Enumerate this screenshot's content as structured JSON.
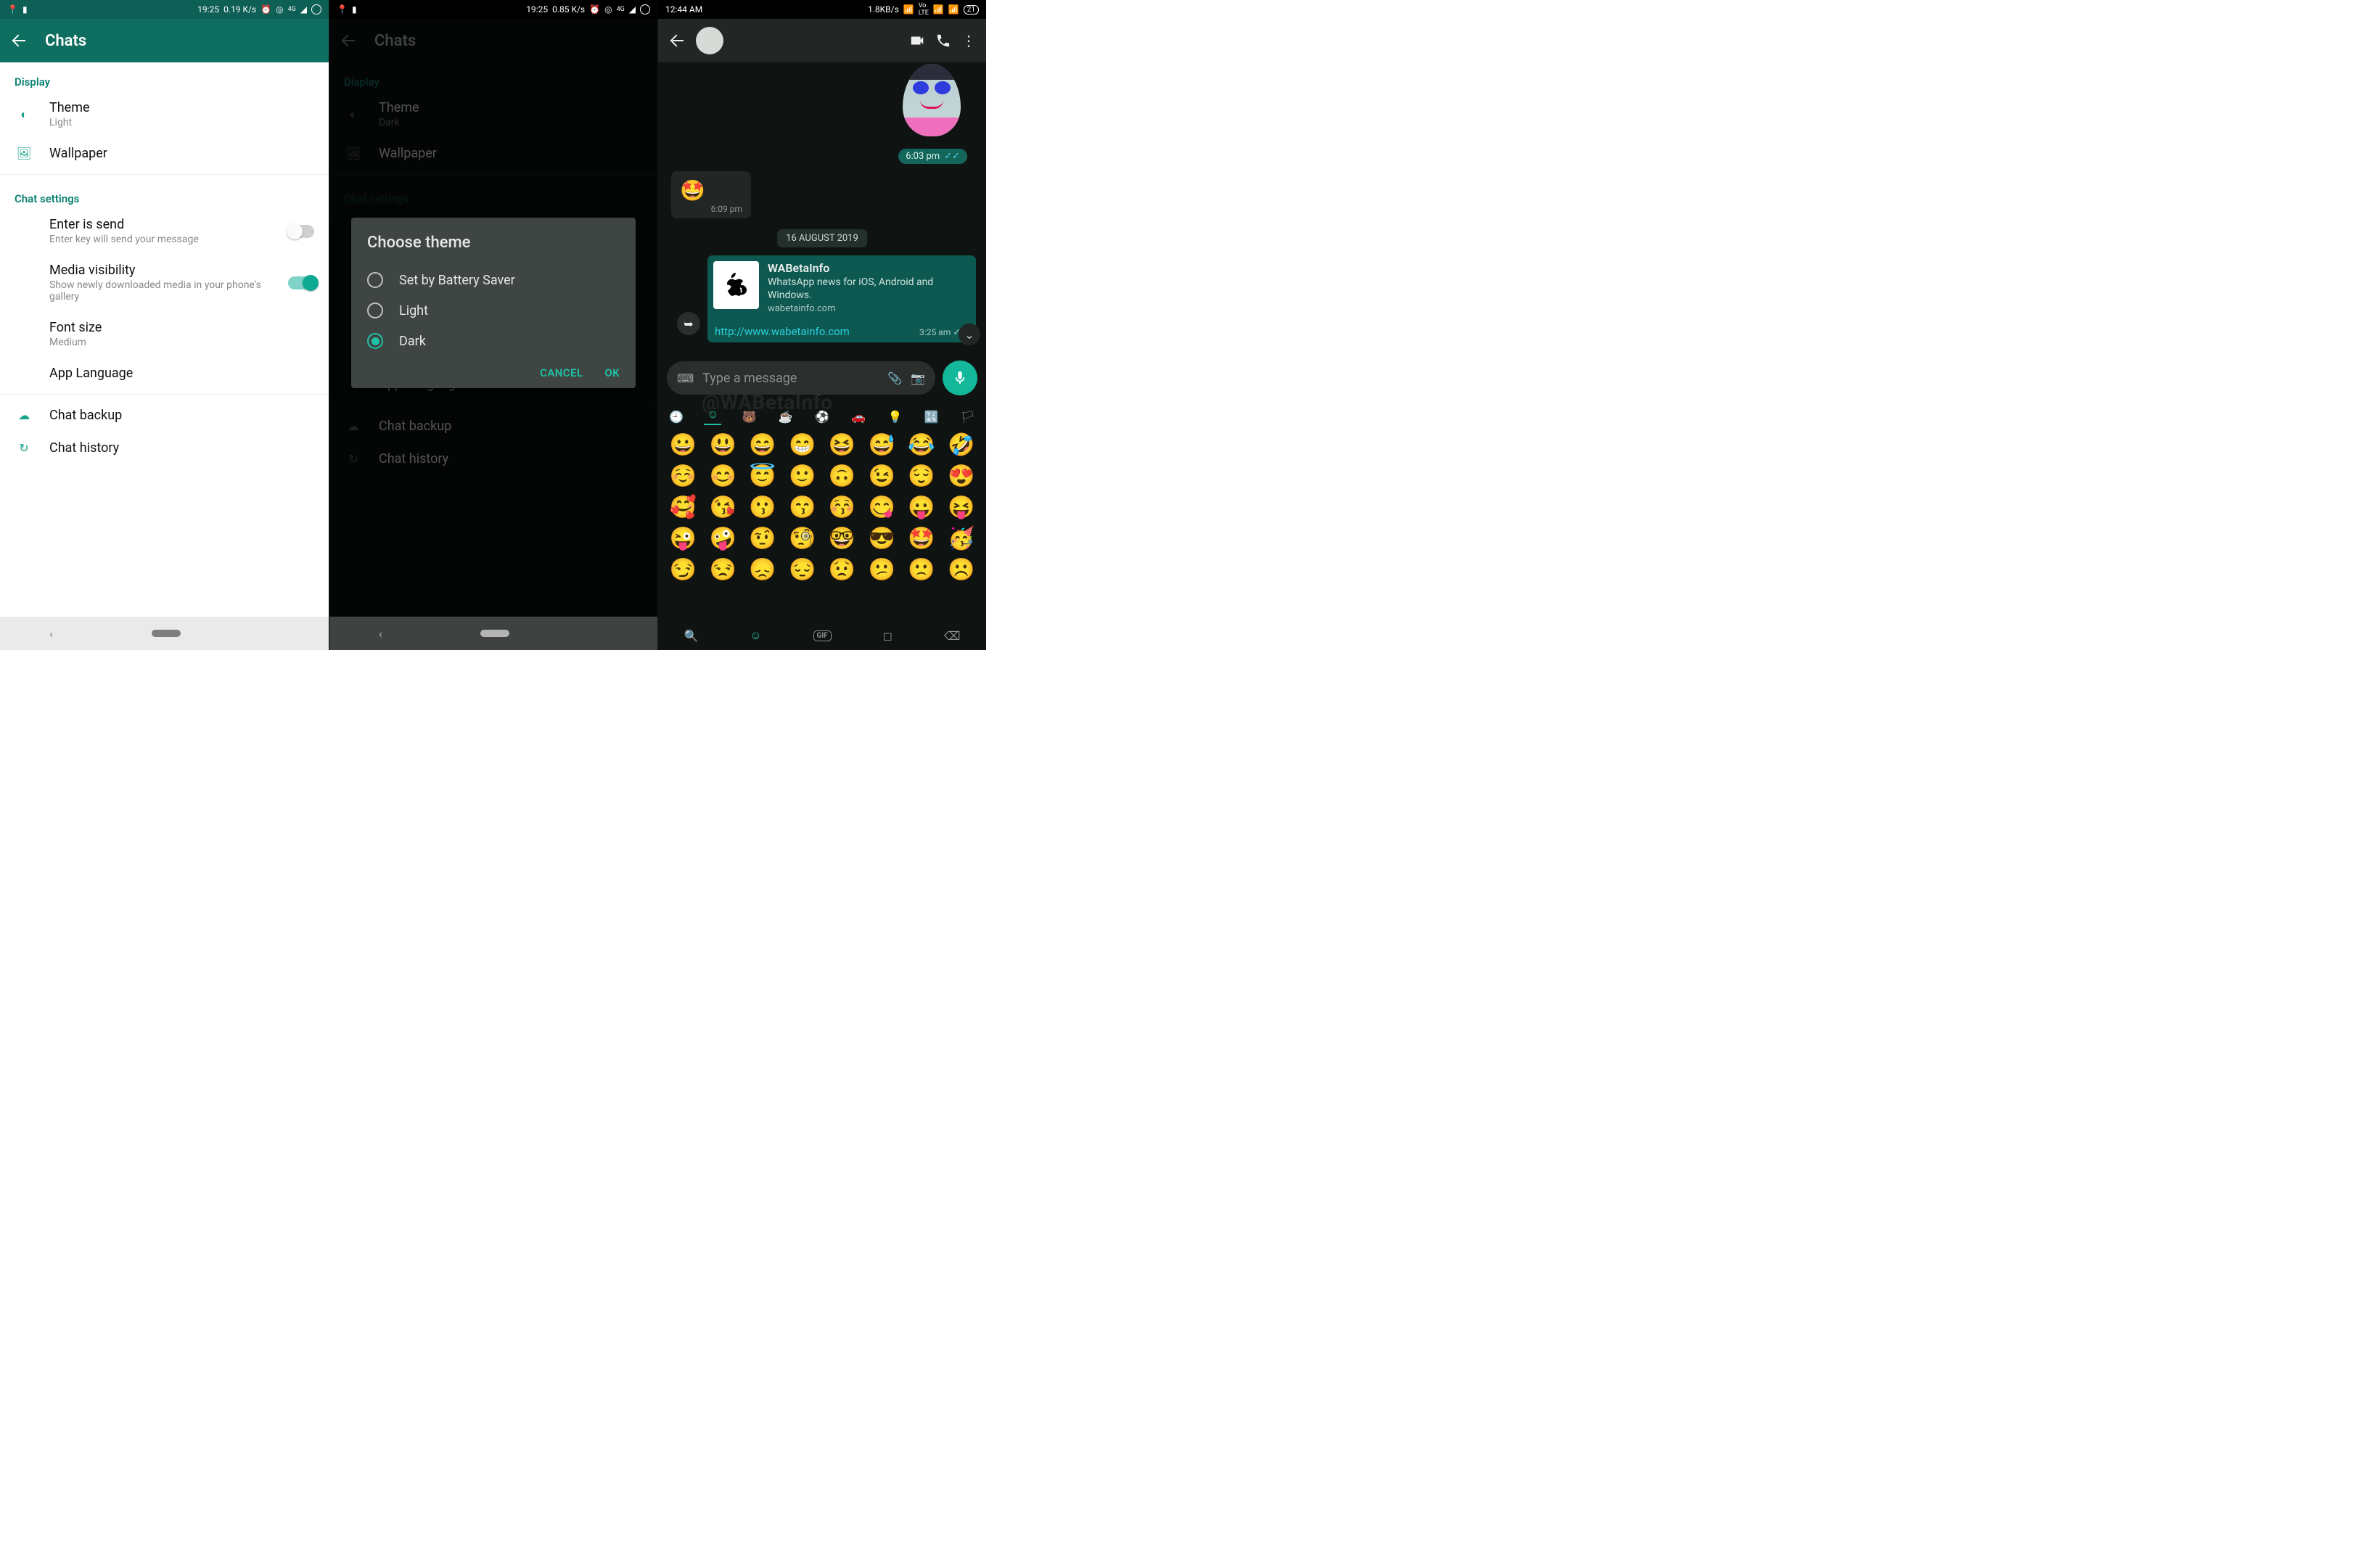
{
  "panelA": {
    "status": {
      "time": "19:25",
      "net": "0.19 K/s"
    },
    "header_title": "Chats",
    "section_display": "Display",
    "theme": {
      "title": "Theme",
      "value": "Light"
    },
    "wallpaper": "Wallpaper",
    "section_chat": "Chat settings",
    "enter_is_send": {
      "title": "Enter is send",
      "sub": "Enter key will send your message",
      "on": false
    },
    "media_vis": {
      "title": "Media visibility",
      "sub": "Show newly downloaded media in your phone's gallery",
      "on": true
    },
    "font_size": {
      "title": "Font size",
      "value": "Medium"
    },
    "app_lang": "App Language",
    "chat_backup": "Chat backup",
    "chat_history": "Chat history"
  },
  "panelB": {
    "status": {
      "time": "19:25",
      "net": "0.85 K/s"
    },
    "header_title": "Chats",
    "section_display": "Display",
    "theme": {
      "title": "Theme",
      "value": "Dark"
    },
    "wallpaper": "Wallpaper",
    "section_chat": "Chat settings",
    "app_lang": "App Language",
    "chat_backup": "Chat backup",
    "chat_history": "Chat history",
    "dialog": {
      "title": "Choose theme",
      "options": [
        "Set by Battery Saver",
        "Light",
        "Dark"
      ],
      "selected_index": 2,
      "cancel": "CANCEL",
      "ok": "OK"
    }
  },
  "panelC": {
    "status": {
      "time": "12:44 AM",
      "net": "1.8KB/s",
      "batt": "21"
    },
    "sticker_time": "6:03 pm",
    "incoming": {
      "emoji": "🤩",
      "time": "6:09 pm"
    },
    "date_chip": "16 AUGUST 2019",
    "link": {
      "title": "WABetaInfo",
      "desc": "WhatsApp news for iOS, Android and Windows.",
      "domain": "wabetainfo.com",
      "url": "http://www.wabetainfo.com",
      "time": "3:25 am"
    },
    "input_placeholder": "Type a message",
    "watermark": "@WABetaInfo",
    "emoji_grid": [
      "😀",
      "😃",
      "😄",
      "😁",
      "😆",
      "😅",
      "😂",
      "🤣",
      "☺️",
      "😊",
      "😇",
      "🙂",
      "🙃",
      "😉",
      "😌",
      "😍",
      "🥰",
      "😘",
      "😗",
      "😙",
      "😚",
      "😋",
      "😛",
      "😝",
      "😜",
      "🤪",
      "🤨",
      "🧐",
      "🤓",
      "😎",
      "🤩",
      "🥳",
      "😏",
      "😒",
      "😞",
      "😔",
      "😟",
      "😕",
      "🙁",
      "☹️"
    ],
    "bottom": {
      "gif": "GIF"
    }
  }
}
